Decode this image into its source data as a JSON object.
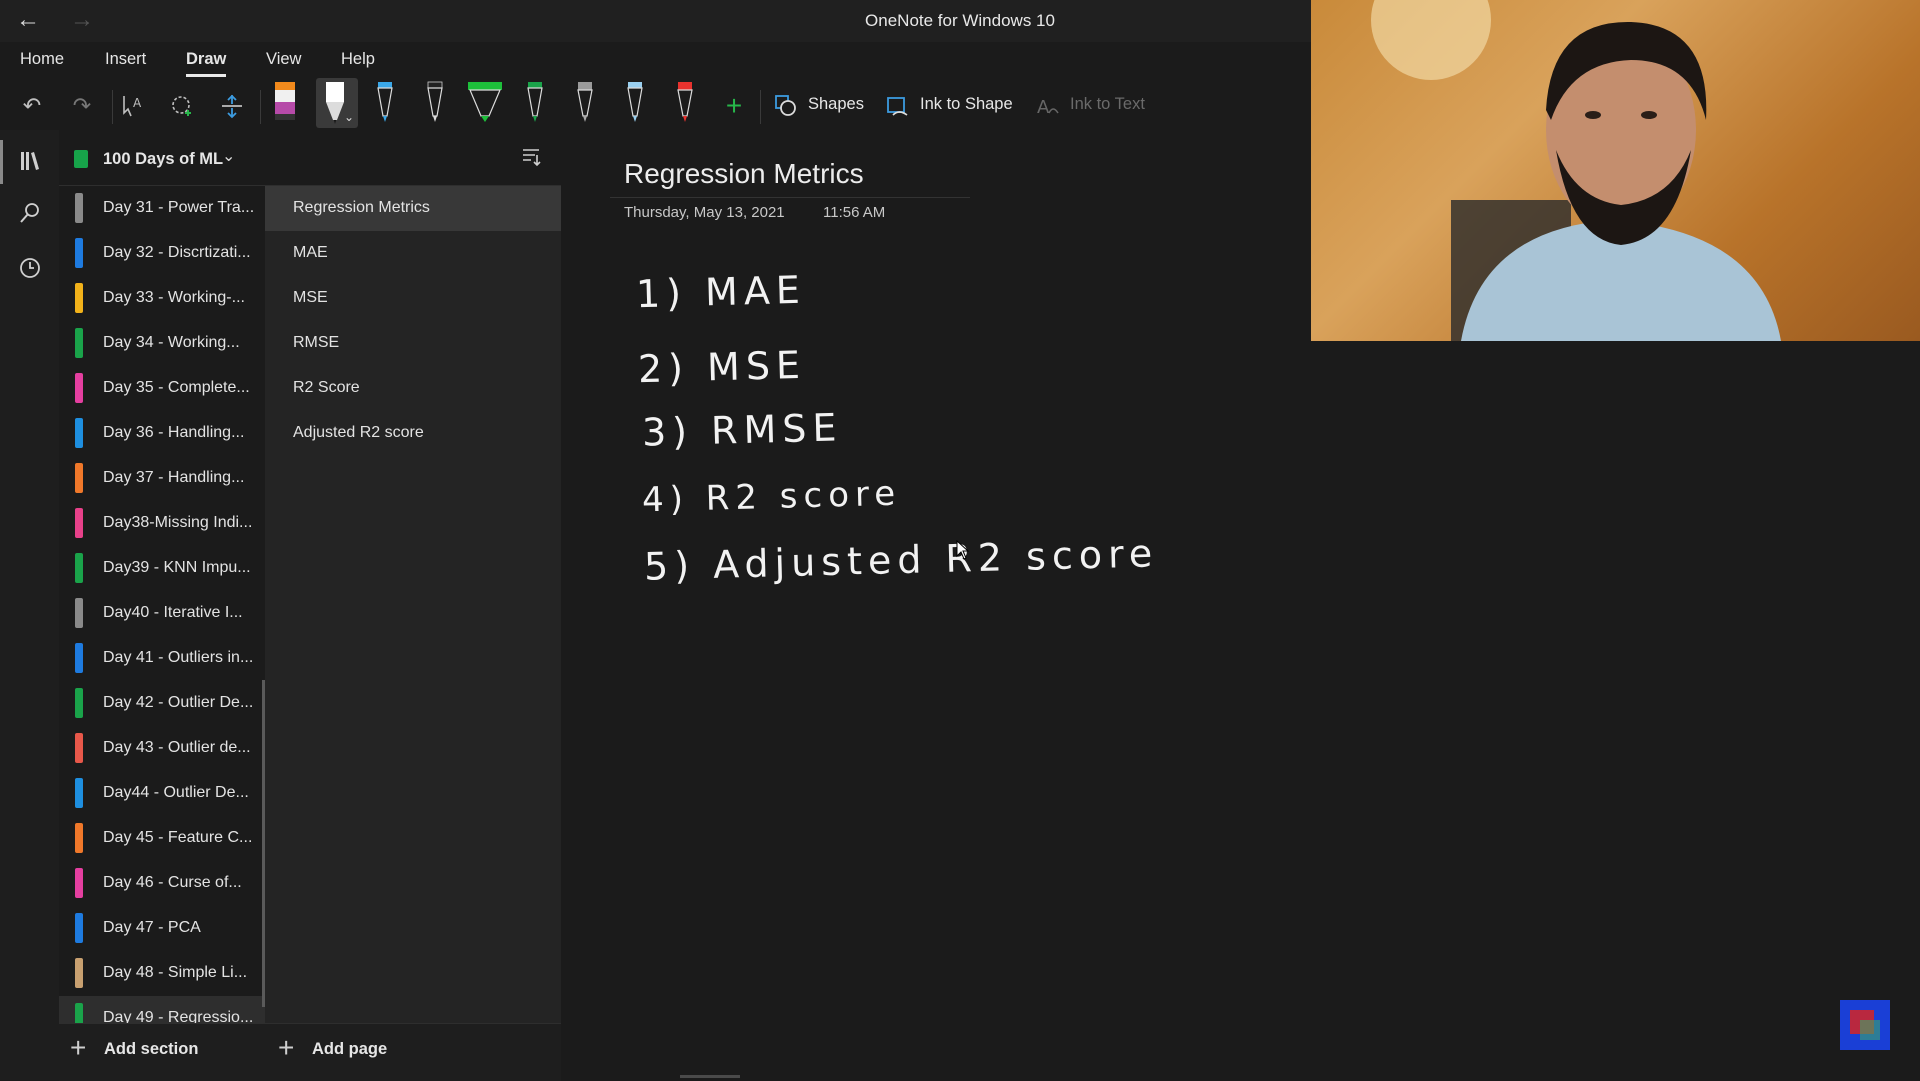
{
  "window": {
    "title": "OneNote for Windows 10"
  },
  "menu": {
    "home": "Home",
    "insert": "Insert",
    "draw": "Draw",
    "view": "View",
    "help": "Help"
  },
  "toolbar": {
    "shapes": "Shapes",
    "ink_to_shape": "Ink to Shape",
    "ink_to_text": "Ink to Text"
  },
  "notebook": {
    "title": "100 Days of ML"
  },
  "sections": [
    {
      "label": "Day 31 - Power Tra...",
      "color": "#8a8a8a"
    },
    {
      "label": "Day 32 - Discrtizati...",
      "color": "#1e7be0"
    },
    {
      "label": "Day 33 - Working-...",
      "color": "#f2b21a"
    },
    {
      "label": "Day 34 - Working...",
      "color": "#1aa34a"
    },
    {
      "label": "Day 35 - Complete...",
      "color": "#e53fa0"
    },
    {
      "label": "Day 36 - Handling...",
      "color": "#1e8fe0"
    },
    {
      "label": "Day 37 - Handling...",
      "color": "#f0782a"
    },
    {
      "label": "Day38-Missing Indi...",
      "color": "#e8418a"
    },
    {
      "label": "Day39 - KNN Impu...",
      "color": "#1aa34a"
    },
    {
      "label": "Day40 - Iterative I...",
      "color": "#8a8a8a"
    },
    {
      "label": "Day 41 - Outliers in...",
      "color": "#1e7be0"
    },
    {
      "label": "Day 42 - Outlier De...",
      "color": "#1aa34a"
    },
    {
      "label": "Day 43 - Outlier de...",
      "color": "#e8584a"
    },
    {
      "label": "Day44 - Outlier De...",
      "color": "#1e8fe0"
    },
    {
      "label": "Day 45 - Feature C...",
      "color": "#f0782a"
    },
    {
      "label": "Day 46 - Curse of...",
      "color": "#e53fa0"
    },
    {
      "label": "Day 47 - PCA",
      "color": "#1e7be0"
    },
    {
      "label": "Day 48 - Simple Li...",
      "color": "#c8a070"
    },
    {
      "label": "Day 49 - Regressio...",
      "color": "#1aa34a"
    }
  ],
  "pages": [
    "Regression Metrics",
    "MAE",
    "MSE",
    "RMSE",
    "R2 Score",
    "Adjusted R2 score"
  ],
  "bottom": {
    "add_section": "Add section",
    "add_page": "Add page"
  },
  "page": {
    "title": "Regression Metrics",
    "date": "Thursday, May 13, 2021",
    "time": "11:56 AM",
    "ink_lines": [
      "1)  MAE",
      "2)  MSE",
      "3)  RMSE",
      "4)  R2 score",
      "5)  Adjusted R2 score"
    ]
  }
}
